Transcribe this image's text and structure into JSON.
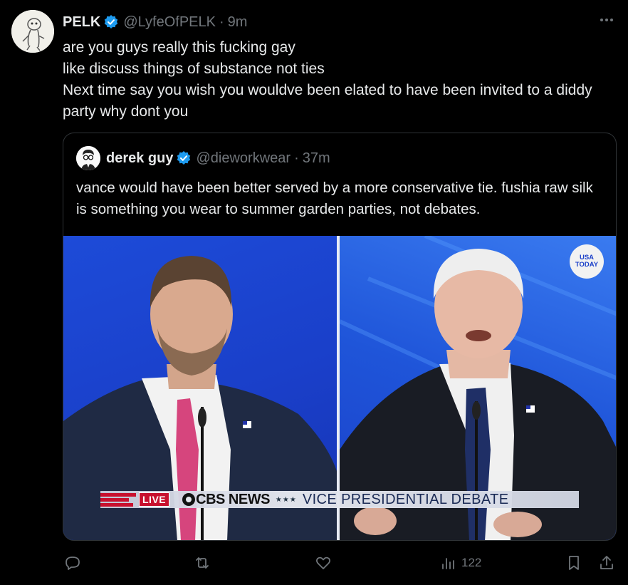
{
  "tweet": {
    "author_name": "PELK",
    "author_handle": "@LyfeOfPELK",
    "separator": "·",
    "time": "9m",
    "lines": [
      "are you guys really this fucking gay",
      "like discuss things of substance not ties",
      "Next time say you wish you wouldve been elated to have been invited to a diddy party why dont you"
    ]
  },
  "quote": {
    "author_name": "derek guy",
    "author_handle": "@dieworkwear",
    "separator": "·",
    "time": "37m",
    "text": "vance would have been better served by a more conservative tie. fushia raw silk is something you wear to summer garden parties, not debates.",
    "media": {
      "badge_line1": "USA",
      "badge_line2": "TODAY",
      "chyron_live": "LIVE",
      "chyron_network": "CBS NEWS",
      "chyron_stars": "★★★",
      "chyron_title": "VICE PRESIDENTIAL DEBATE"
    }
  },
  "actions": {
    "views_count": "122"
  },
  "colors": {
    "background": "#000000",
    "text": "#e7e9ea",
    "muted": "#71767b",
    "verified": "#1d9bf0",
    "border": "#2f3336"
  }
}
